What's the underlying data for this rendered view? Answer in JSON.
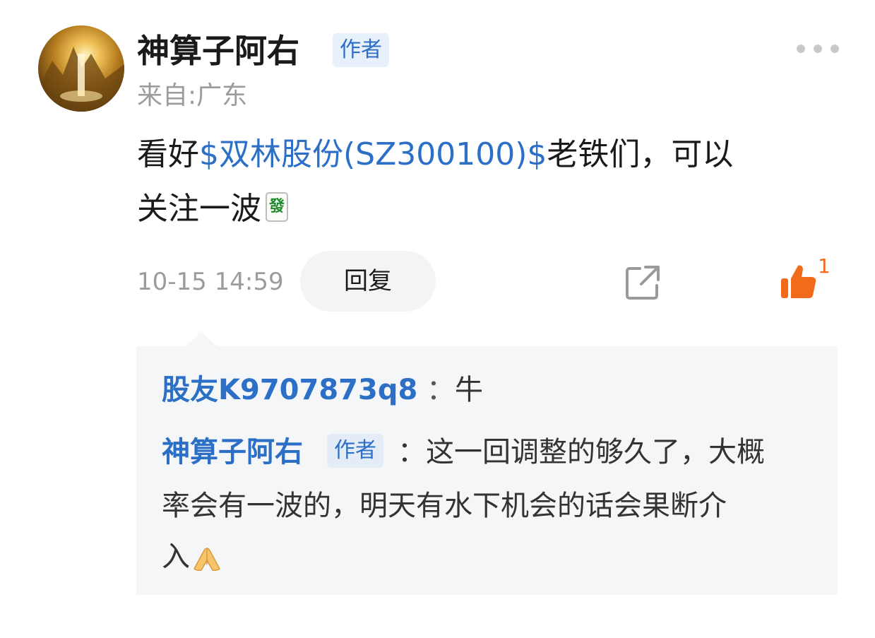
{
  "post": {
    "author": "神算子阿右",
    "author_badge": "作者",
    "location": "来自:广东",
    "content_prefix": "看好",
    "stock_link": "$双林股份(SZ300100)$",
    "content_line1_suffix": "老铁们，可以",
    "content_line2": "关注一波",
    "emoji_tile": "發",
    "time": "10-15 14:59",
    "reply_label": "回复",
    "like_count": "1",
    "icons": {
      "more": "more-dots-icon",
      "share": "share-icon",
      "like": "thumbs-up-icon"
    },
    "colors": {
      "link": "#2b6fc6",
      "like": "#f26b1a",
      "muted": "#9c9c9c"
    }
  },
  "replies": [
    {
      "user": "股友K9707873q8",
      "separator": "：",
      "text": "牛"
    },
    {
      "user": "神算子阿右",
      "badge": "作者",
      "separator": "：",
      "text_line1": "这一回调整的够久了，大概",
      "text_line2": "率会有一波的，明天有水下机会的话会果断介",
      "text_line3": "入"
    }
  ]
}
